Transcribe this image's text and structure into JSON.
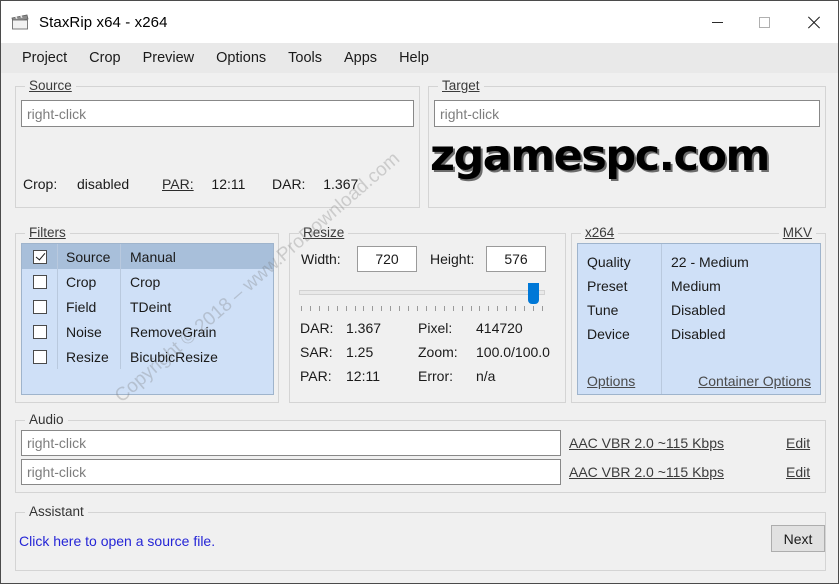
{
  "window": {
    "title": "StaxRip x64 - x264",
    "icon": "clapperboard-icon",
    "minimize_label": "Minimize",
    "maximize_label": "Maximize",
    "close_label": "Close"
  },
  "menubar": {
    "items": [
      {
        "label": "Project"
      },
      {
        "label": "Crop"
      },
      {
        "label": "Preview"
      },
      {
        "label": "Options"
      },
      {
        "label": "Tools"
      },
      {
        "label": "Apps"
      },
      {
        "label": "Help"
      }
    ]
  },
  "source": {
    "legend": "Source",
    "input_placeholder": "right-click",
    "input_value": "",
    "crop_label": "Crop:",
    "crop_value": "disabled",
    "par_label": "PAR:",
    "par_value": "12:11",
    "dar_label": "DAR:",
    "dar_value": "1.367"
  },
  "target": {
    "legend": "Target",
    "input_placeholder": "right-click",
    "input_value": ""
  },
  "filters": {
    "legend": "Filters",
    "rows": [
      {
        "checked": true,
        "name": "Source",
        "value": "Manual",
        "selected": true
      },
      {
        "checked": false,
        "name": "Crop",
        "value": "Crop",
        "selected": false
      },
      {
        "checked": false,
        "name": "Field",
        "value": "TDeint",
        "selected": false
      },
      {
        "checked": false,
        "name": "Noise",
        "value": "RemoveGrain",
        "selected": false
      },
      {
        "checked": false,
        "name": "Resize",
        "value": "BicubicResize",
        "selected": false
      }
    ]
  },
  "resize": {
    "legend": "Resize",
    "width_label": "Width:",
    "width_value": "720",
    "height_label": "Height:",
    "height_value": "576",
    "slider_percent": 100,
    "stats": {
      "dar_label": "DAR:",
      "dar_value": "1.367",
      "sar_label": "SAR:",
      "sar_value": "1.25",
      "par_label": "PAR:",
      "par_value": "12:11",
      "pixel_label": "Pixel:",
      "pixel_value": "414720",
      "zoom_label": "Zoom:",
      "zoom_value": "100.0/100.0",
      "error_label": "Error:",
      "error_value": "n/a"
    }
  },
  "encoder": {
    "legend": "x264",
    "container_legend": "MKV",
    "rows": [
      {
        "key": "Quality",
        "value": "22 - Medium"
      },
      {
        "key": "Preset",
        "value": "Medium"
      },
      {
        "key": "Tune",
        "value": "Disabled"
      },
      {
        "key": "Device",
        "value": "Disabled"
      }
    ],
    "options_link": "Options",
    "container_options_link": "Container Options"
  },
  "audio": {
    "legend": "Audio",
    "tracks": [
      {
        "placeholder": "right-click",
        "value": "",
        "profile": "AAC VBR 2.0 ~115 Kbps",
        "edit": "Edit"
      },
      {
        "placeholder": "right-click",
        "value": "",
        "profile": "AAC VBR 2.0 ~115 Kbps",
        "edit": "Edit"
      }
    ]
  },
  "assistant": {
    "legend": "Assistant",
    "link": "Click here to open a source file.",
    "next_button": "Next"
  },
  "watermarks": {
    "brand": "zgamespc.com",
    "diagonal": "Copyright © 2018 – www.ProDownload.com"
  },
  "colors": {
    "window_bg": "#f0f0f0",
    "accent_blue": "#0078d7",
    "list_bg": "#cfe0f7",
    "list_selected": "#a8bfda",
    "link_blue": "#2525d6"
  }
}
